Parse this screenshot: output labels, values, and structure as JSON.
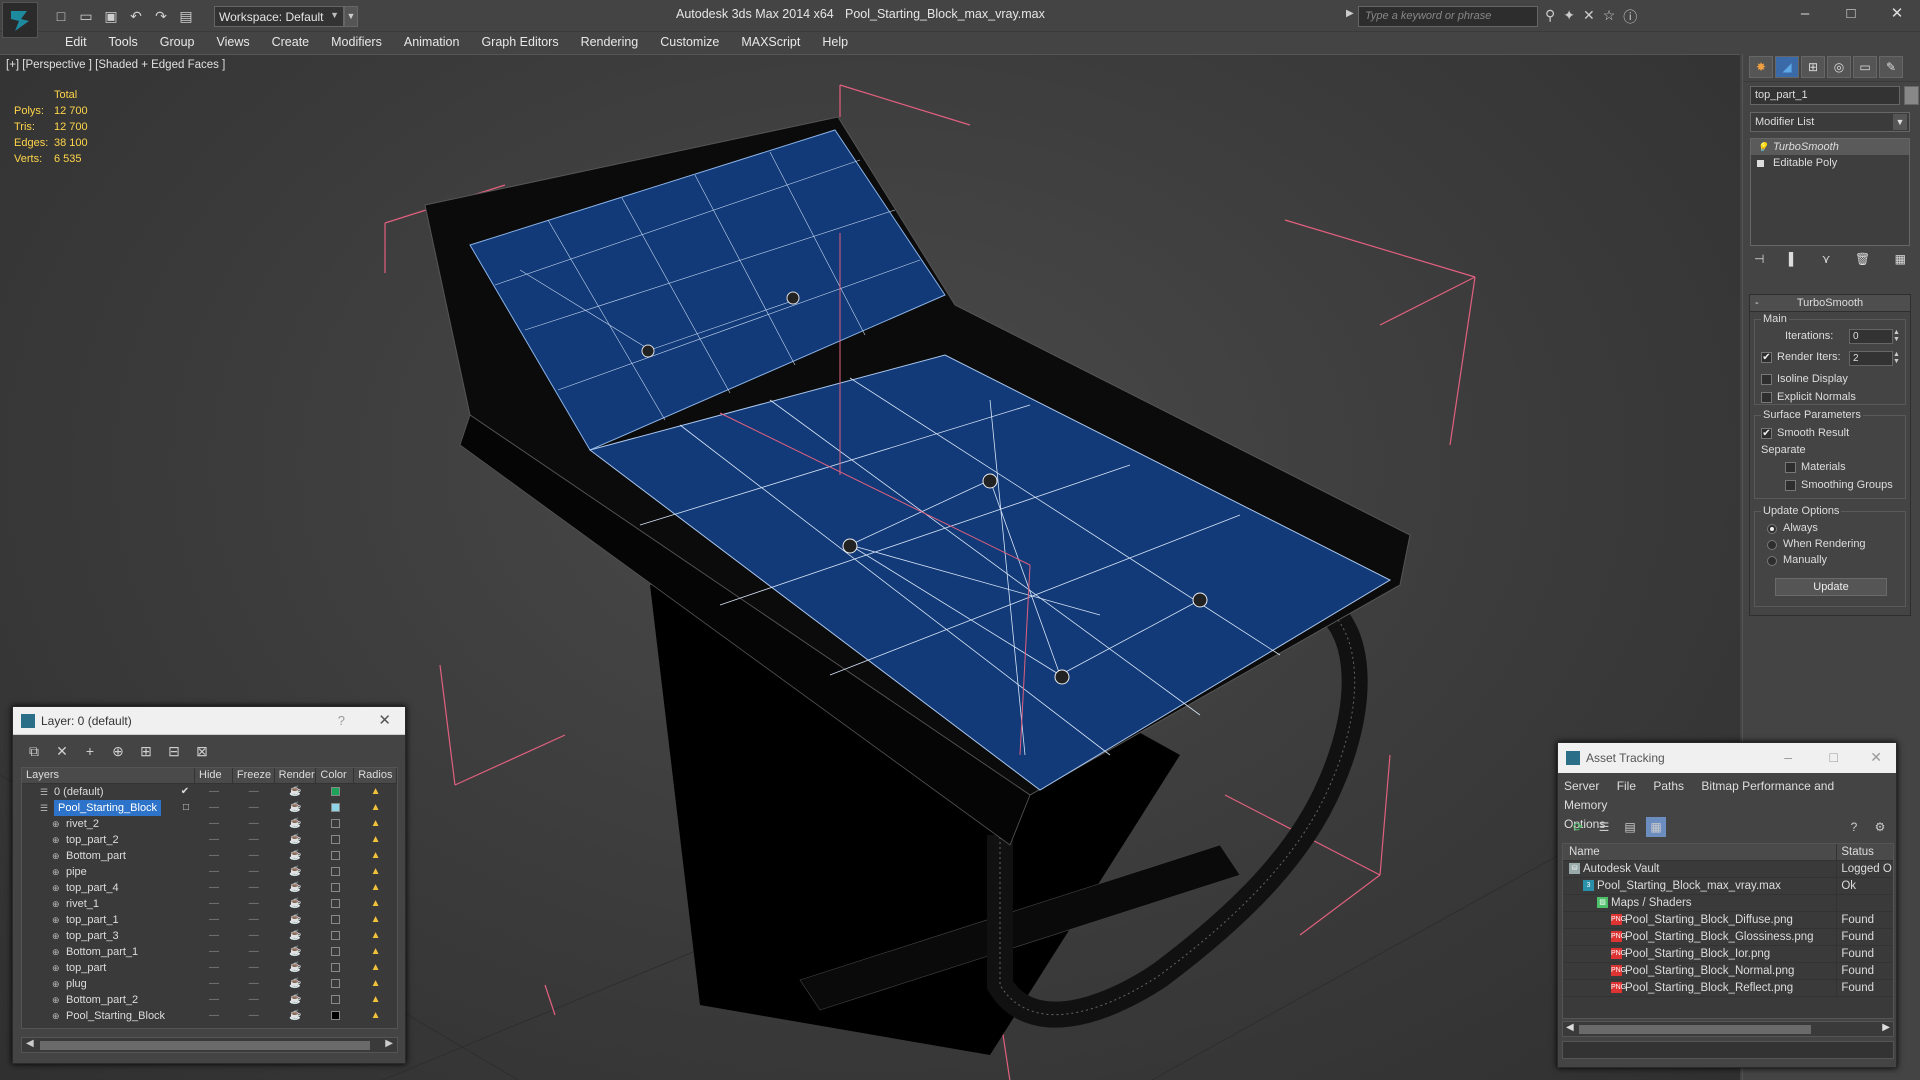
{
  "titlebar": {
    "workspace": "Workspace: Default",
    "app_title": "Autodesk 3ds Max  2014 x64",
    "file_title": "Pool_Starting_Block_max_vray.max",
    "search_placeholder": "Type a keyword or phrase"
  },
  "menu": [
    "Edit",
    "Tools",
    "Group",
    "Views",
    "Create",
    "Modifiers",
    "Animation",
    "Graph Editors",
    "Rendering",
    "Customize",
    "MAXScript",
    "Help"
  ],
  "viewport": {
    "label": "[+] [Perspective ] [Shaded + Edged Faces ]",
    "stats": {
      "header": "Total",
      "rows": [
        {
          "k": "Polys:",
          "v": "12 700"
        },
        {
          "k": "Tris:",
          "v": "12 700"
        },
        {
          "k": "Edges:",
          "v": "38 100"
        },
        {
          "k": "Verts:",
          "v": "6 535"
        }
      ]
    }
  },
  "command_panel": {
    "object_name": "top_part_1",
    "modifier_list": "Modifier List",
    "stack": [
      "TurboSmooth",
      "Editable Poly"
    ],
    "turbosmooth": {
      "title": "TurboSmooth",
      "main_label": "Main",
      "iterations_label": "Iterations:",
      "iterations_value": "0",
      "render_iters_label": "Render Iters:",
      "render_iters_value": "2",
      "isoline_label": "Isoline Display",
      "explicit_normals_label": "Explicit Normals",
      "surface_params_label": "Surface Parameters",
      "smooth_result_label": "Smooth Result",
      "separate_label": "Separate",
      "materials_label": "Materials",
      "smoothing_groups_label": "Smoothing Groups",
      "update_options_label": "Update Options",
      "always_label": "Always",
      "when_rendering_label": "When Rendering",
      "manually_label": "Manually",
      "update_button": "Update"
    }
  },
  "layer_explorer": {
    "title": "Layer: 0 (default)",
    "help": "?",
    "columns": [
      "Layers",
      "Hide",
      "Freeze",
      "Render",
      "Color",
      "Radios"
    ],
    "rows": [
      {
        "name": "0 (default)",
        "level": 1,
        "color": "#1fa35a",
        "selected": false
      },
      {
        "name": "Pool_Starting_Block",
        "level": 1,
        "color": "#8fd4e6",
        "selected": true
      },
      {
        "name": "rivet_2",
        "level": 2,
        "color": "#3a3a3a",
        "selected": false
      },
      {
        "name": "top_part_2",
        "level": 2,
        "color": "#3a3a3a",
        "selected": false
      },
      {
        "name": "Bottom_part",
        "level": 2,
        "color": "#3a3a3a",
        "selected": false
      },
      {
        "name": "pipe",
        "level": 2,
        "color": "#3a3a3a",
        "selected": false
      },
      {
        "name": "top_part_4",
        "level": 2,
        "color": "#3a3a3a",
        "selected": false
      },
      {
        "name": "rivet_1",
        "level": 2,
        "color": "#3a3a3a",
        "selected": false
      },
      {
        "name": "top_part_1",
        "level": 2,
        "color": "#3a3a3a",
        "selected": false
      },
      {
        "name": "top_part_3",
        "level": 2,
        "color": "#3a3a3a",
        "selected": false
      },
      {
        "name": "Bottom_part_1",
        "level": 2,
        "color": "#3a3a3a",
        "selected": false
      },
      {
        "name": "top_part",
        "level": 2,
        "color": "#3a3a3a",
        "selected": false
      },
      {
        "name": "plug",
        "level": 2,
        "color": "#3a3a3a",
        "selected": false
      },
      {
        "name": "Bottom_part_2",
        "level": 2,
        "color": "#3a3a3a",
        "selected": false
      },
      {
        "name": "Pool_Starting_Block",
        "level": 2,
        "color": "#000000",
        "selected": false
      }
    ]
  },
  "asset_tracking": {
    "title": "Asset Tracking",
    "menu_line1": [
      "Server",
      "File",
      "Paths",
      "Bitmap Performance and Memory"
    ],
    "menu_line2": [
      "Options"
    ],
    "columns": [
      "Name",
      "Status"
    ],
    "rows": [
      {
        "name": "Autodesk Vault",
        "indent": 1,
        "icon": "vault-icon",
        "status": "Logged O"
      },
      {
        "name": "Pool_Starting_Block_max_vray.max",
        "indent": 2,
        "icon": "max-file-icon",
        "status": "Ok"
      },
      {
        "name": "Maps / Shaders",
        "indent": 3,
        "icon": "maps-icon",
        "status": ""
      },
      {
        "name": "Pool_Starting_Block_Diffuse.png",
        "indent": 4,
        "icon": "png-file-icon",
        "status": "Found"
      },
      {
        "name": "Pool_Starting_Block_Glossiness.png",
        "indent": 4,
        "icon": "png-file-icon",
        "status": "Found"
      },
      {
        "name": "Pool_Starting_Block_Ior.png",
        "indent": 4,
        "icon": "png-file-icon",
        "status": "Found"
      },
      {
        "name": "Pool_Starting_Block_Normal.png",
        "indent": 4,
        "icon": "png-file-icon",
        "status": "Found"
      },
      {
        "name": "Pool_Starting_Block_Reflect.png",
        "indent": 4,
        "icon": "png-file-icon",
        "status": "Found"
      }
    ]
  },
  "colors": {
    "accent_blue": "#2d73c9",
    "stats_yellow": "#ffd54a",
    "mesh_blue": "#123a78",
    "gizmo_pink": "#e0607e"
  }
}
